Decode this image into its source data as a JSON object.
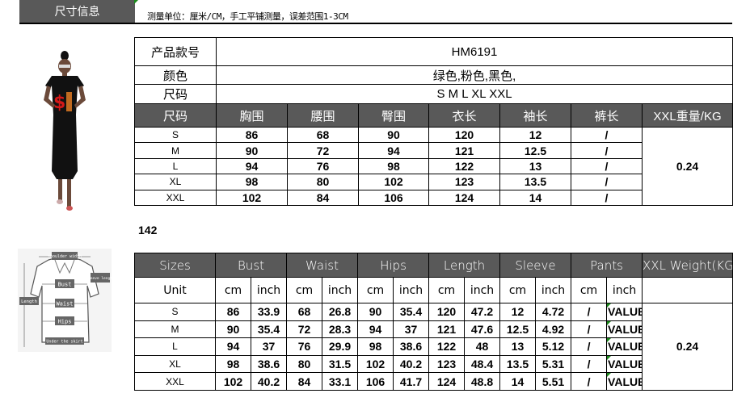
{
  "header": {
    "tab_label": "尺寸信息",
    "note": "测量单位：厘米/CM，手工平铺测量，误差范围1-3CM"
  },
  "cn_table": {
    "product_label": "产品款号",
    "product_value": "HM6191",
    "color_label": "颜色",
    "color_value": "绿色,粉色,黑色,",
    "size_label": "尺码",
    "size_value": "S M L XL XXL",
    "columns": [
      "尺码",
      "胸围",
      "腰围",
      "臀围",
      "衣长",
      "袖长",
      "裤长",
      "XXL重量/KG"
    ],
    "rows": [
      [
        "S",
        "86",
        "68",
        "90",
        "120",
        "12",
        "/"
      ],
      [
        "M",
        "90",
        "72",
        "94",
        "121",
        "12.5",
        "/"
      ],
      [
        "L",
        "94",
        "76",
        "98",
        "122",
        "13",
        "/"
      ],
      [
        "XL",
        "98",
        "80",
        "102",
        "123",
        "13.5",
        "/"
      ],
      [
        "XXL",
        "102",
        "84",
        "106",
        "124",
        "14",
        "/"
      ]
    ],
    "weight": "0.24"
  },
  "label_142": "142",
  "en_table": {
    "columns": [
      "Sizes",
      "Bust",
      "Waist",
      "Hips",
      "Length",
      "Sleeve",
      "Pants",
      "XXL Weight(KG)"
    ],
    "unit_label": "Unit",
    "units": [
      "cm",
      "inch",
      "cm",
      "inch",
      "cm",
      "inch",
      "cm",
      "inch",
      "cm",
      "inch",
      "cm",
      "inch"
    ],
    "rows": [
      [
        "S",
        "86",
        "33.9",
        "68",
        "26.8",
        "90",
        "35.4",
        "120",
        "47.2",
        "12",
        "4.72",
        "/",
        "VALUE"
      ],
      [
        "M",
        "90",
        "35.4",
        "72",
        "28.3",
        "94",
        "37",
        "121",
        "47.6",
        "12.5",
        "4.92",
        "/",
        "VALUE"
      ],
      [
        "L",
        "94",
        "37",
        "76",
        "29.9",
        "98",
        "38.6",
        "122",
        "48",
        "13",
        "5.12",
        "/",
        "VALUE"
      ],
      [
        "XL",
        "98",
        "38.6",
        "80",
        "31.5",
        "102",
        "40.2",
        "123",
        "48.4",
        "13.5",
        "5.31",
        "/",
        "VALUE"
      ],
      [
        "XXL",
        "102",
        "40.2",
        "84",
        "33.1",
        "106",
        "41.7",
        "124",
        "48.8",
        "14",
        "5.51",
        "/",
        "VALUE"
      ]
    ],
    "weight": "0.24"
  },
  "diagram": {
    "labels": [
      "shoulder width",
      "sleeve length",
      "Bust",
      "Length",
      "Waist",
      "Hips",
      "Under the skirt"
    ]
  }
}
